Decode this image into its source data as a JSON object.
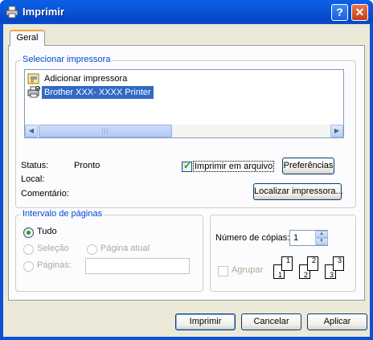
{
  "window": {
    "title": "Imprimir",
    "help_glyph": "?",
    "close_glyph": "✕"
  },
  "tabs": [
    {
      "label": "Geral"
    }
  ],
  "select_printer": {
    "group_label": "Selecionar impressora",
    "printers": [
      {
        "label": "Adicionar impressora",
        "icon": "add-printer-icon",
        "selected": false
      },
      {
        "label": "Brother XXX- XXXX    Printer",
        "icon": "printer-icon",
        "selected": true
      }
    ],
    "scroll": {
      "left_arrow": "◀",
      "right_arrow": "▶",
      "thumb_grip": "|||"
    }
  },
  "status": {
    "status_label": "Status:",
    "status_value": "Pronto",
    "location_label": "Local:",
    "location_value": "",
    "comment_label": "Comentário:",
    "comment_value": ""
  },
  "print_to_file": {
    "label": "Imprimir em arquivo",
    "checked": true
  },
  "buttons": {
    "preferences": "Preferências",
    "find_printer": "Localizar impressora...",
    "print": "Imprimir",
    "cancel": "Cancelar",
    "apply": "Aplicar"
  },
  "page_range": {
    "group_label": "Intervalo de páginas",
    "all": "Tudo",
    "selection": "Seleção",
    "current_page": "Página atual",
    "pages": "Páginas:",
    "pages_value": "",
    "selected_option": "all"
  },
  "copies": {
    "label": "Número de cópias:",
    "value": "1",
    "collate_label": "Agrupar",
    "collate_checked": false,
    "collate_pages": [
      "1",
      "1",
      "2",
      "2",
      "3",
      "3"
    ]
  },
  "colors": {
    "title_bar": "#0a52d6",
    "group_label": "#0046d5",
    "selection": "#316ac5",
    "dialog_bg": "#ece9d8"
  }
}
